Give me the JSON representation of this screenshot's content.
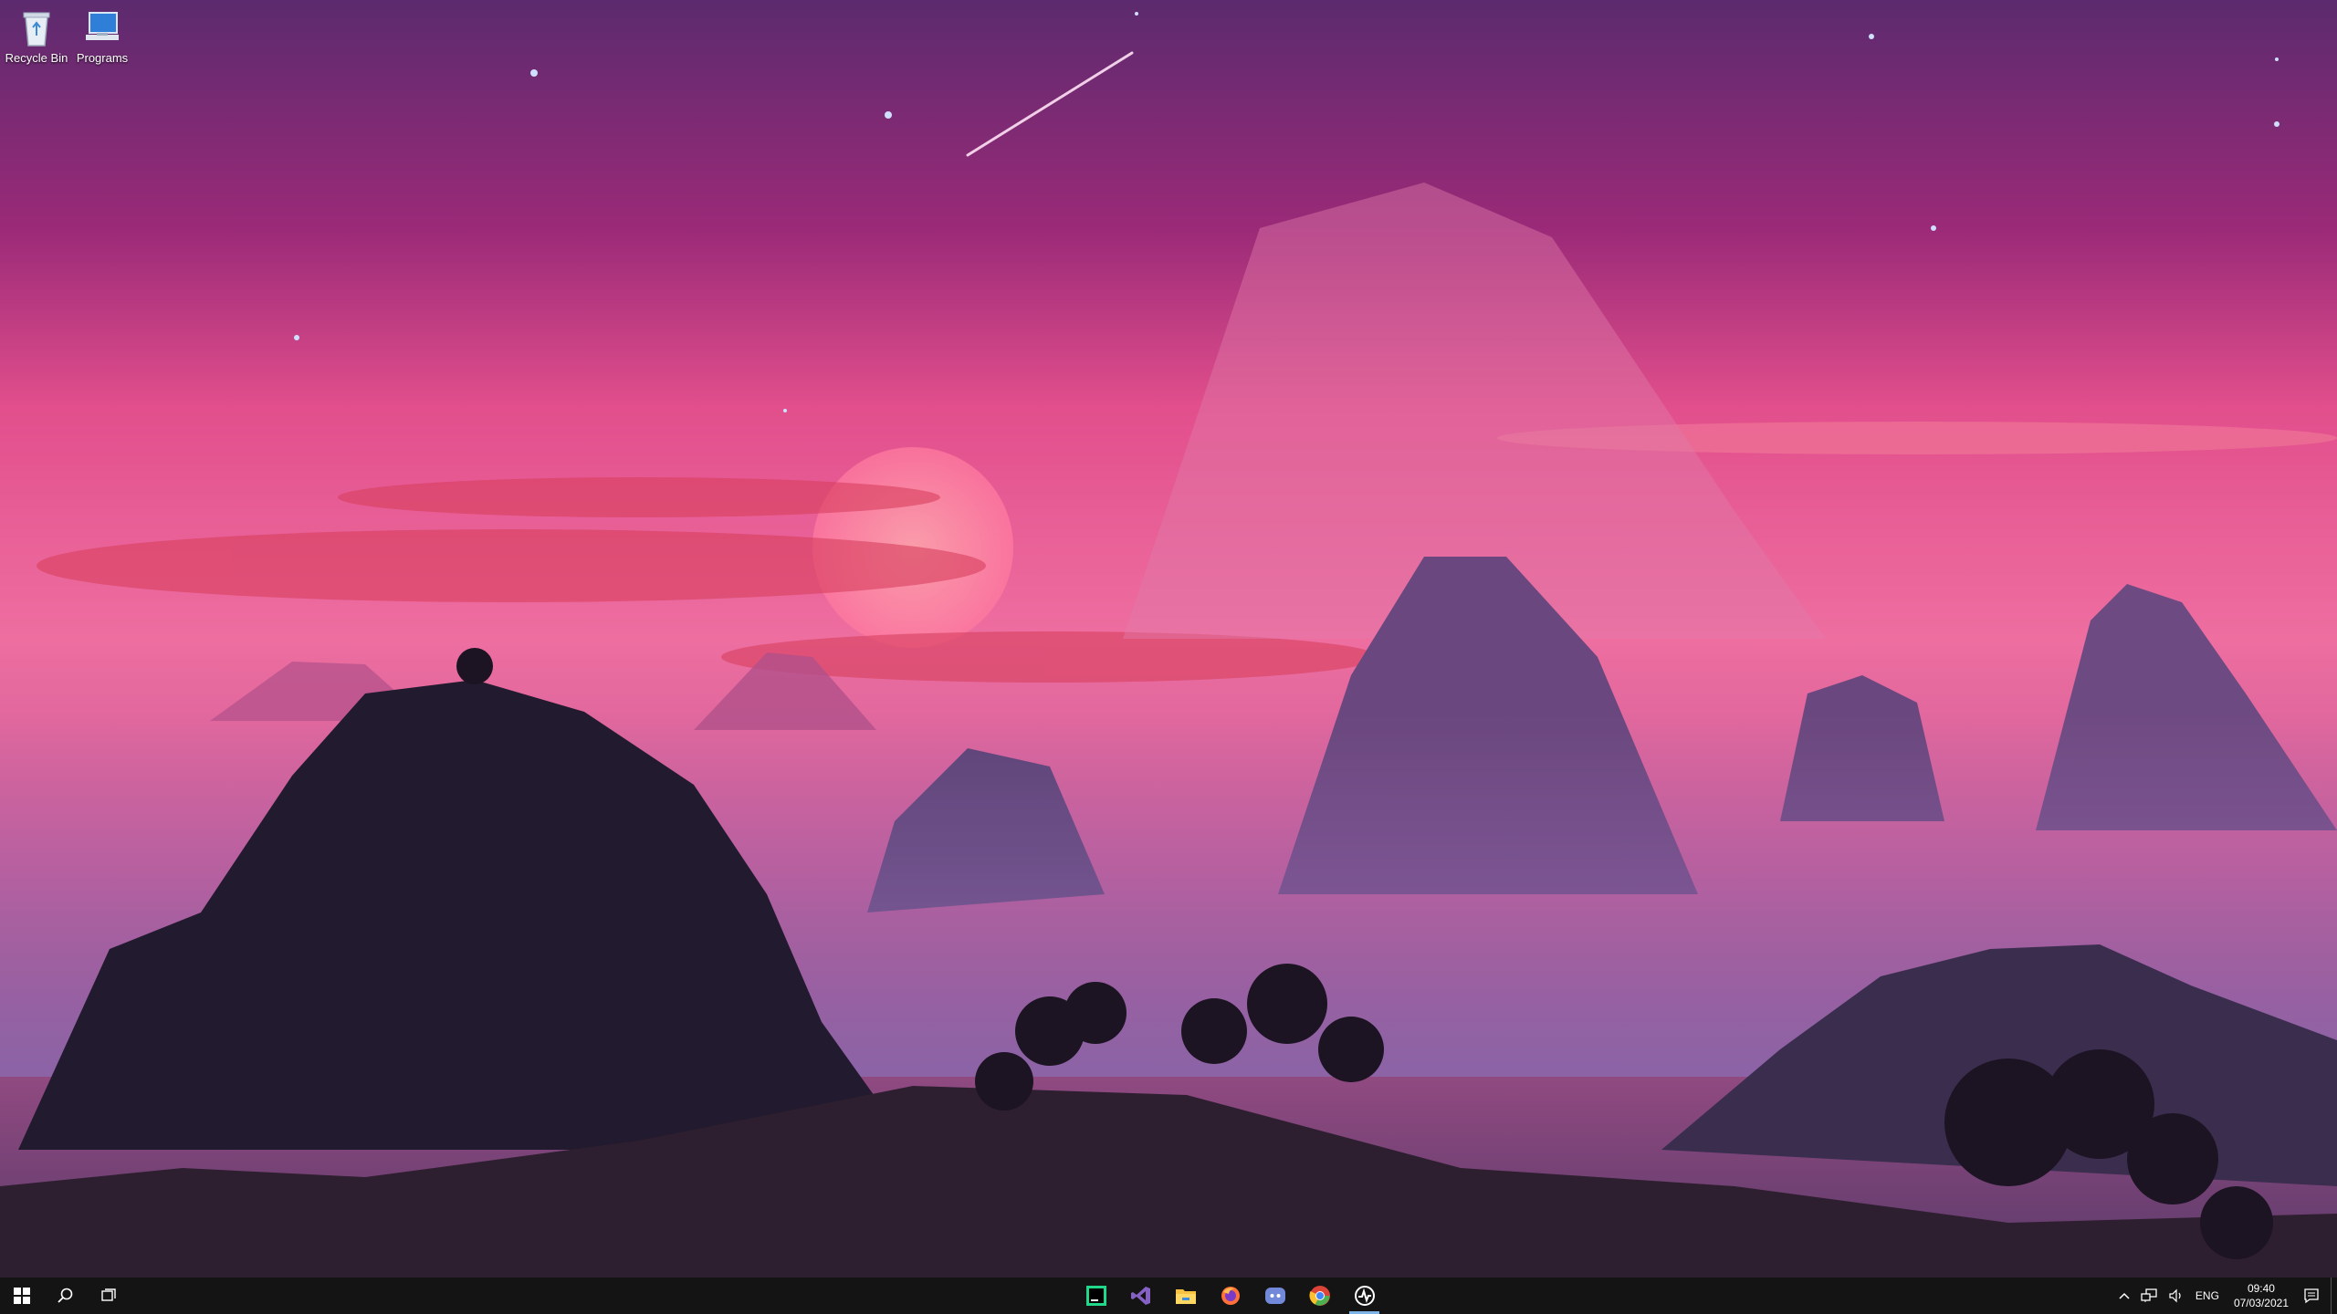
{
  "desktop": {
    "icons": [
      {
        "label": "Recycle Bin",
        "icon": "recycle-bin-icon"
      },
      {
        "label": "Programs",
        "icon": "computer-icon"
      }
    ]
  },
  "taskbar": {
    "start_icon": "windows-start-icon",
    "search_icon": "search-icon",
    "task_view_icon": "task-view-icon",
    "pinned_apps": [
      {
        "name": "pycharm-icon",
        "color": "#21d789"
      },
      {
        "name": "visual-studio-icon",
        "color": "#8661c5"
      },
      {
        "name": "file-explorer-icon",
        "color": "#f5c242"
      },
      {
        "name": "firefox-icon",
        "color": "#ff7139"
      },
      {
        "name": "discord-icon",
        "color": "#7289da"
      },
      {
        "name": "chrome-icon",
        "color": "#4caf50"
      },
      {
        "name": "app-icon-active",
        "color": "#ffffff"
      }
    ],
    "tray": {
      "language": "ENG",
      "time": "09:40",
      "date": "07/03/2021"
    }
  },
  "colors": {
    "taskbar_bg": "#141414",
    "active_indicator": "#7fb4e8"
  }
}
